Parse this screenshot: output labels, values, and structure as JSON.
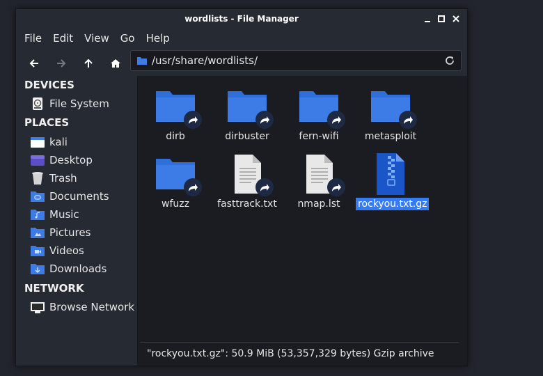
{
  "window": {
    "title": "wordlists - File Manager"
  },
  "menu": [
    "File",
    "Edit",
    "View",
    "Go",
    "Help"
  ],
  "location": {
    "path": "/usr/share/wordlists/"
  },
  "sidebar": {
    "devices_heading": "DEVICES",
    "devices": [
      {
        "label": "File System",
        "icon": "harddisk-icon"
      }
    ],
    "places_heading": "PLACES",
    "places": [
      {
        "label": "kali",
        "icon": "home-folder-icon"
      },
      {
        "label": "Desktop",
        "icon": "desktop-icon"
      },
      {
        "label": "Trash",
        "icon": "trash-icon"
      },
      {
        "label": "Documents",
        "icon": "documents-folder-icon"
      },
      {
        "label": "Music",
        "icon": "music-folder-icon"
      },
      {
        "label": "Pictures",
        "icon": "pictures-folder-icon"
      },
      {
        "label": "Videos",
        "icon": "videos-folder-icon"
      },
      {
        "label": "Downloads",
        "icon": "downloads-folder-icon"
      }
    ],
    "network_heading": "NETWORK",
    "network": [
      {
        "label": "Browse Network",
        "icon": "network-icon"
      }
    ]
  },
  "files": [
    {
      "name": "dirb",
      "type": "folder-link",
      "selected": false
    },
    {
      "name": "dirbuster",
      "type": "folder-link",
      "selected": false
    },
    {
      "name": "fern-wifi",
      "type": "folder-link",
      "selected": false
    },
    {
      "name": "metasploit",
      "type": "folder-link",
      "selected": false
    },
    {
      "name": "wfuzz",
      "type": "folder-link",
      "selected": false
    },
    {
      "name": "fasttrack.txt",
      "type": "text-link",
      "selected": false
    },
    {
      "name": "nmap.lst",
      "type": "text-link",
      "selected": false
    },
    {
      "name": "rockyou.txt.gz",
      "type": "archive",
      "selected": true
    }
  ],
  "status": {
    "text": "\"rockyou.txt.gz\": 50.9 MiB (53,357,329 bytes) Gzip archive"
  },
  "colors": {
    "accent": "#367bf0",
    "folder": "#3d7be6",
    "background": "#1a1c22"
  }
}
